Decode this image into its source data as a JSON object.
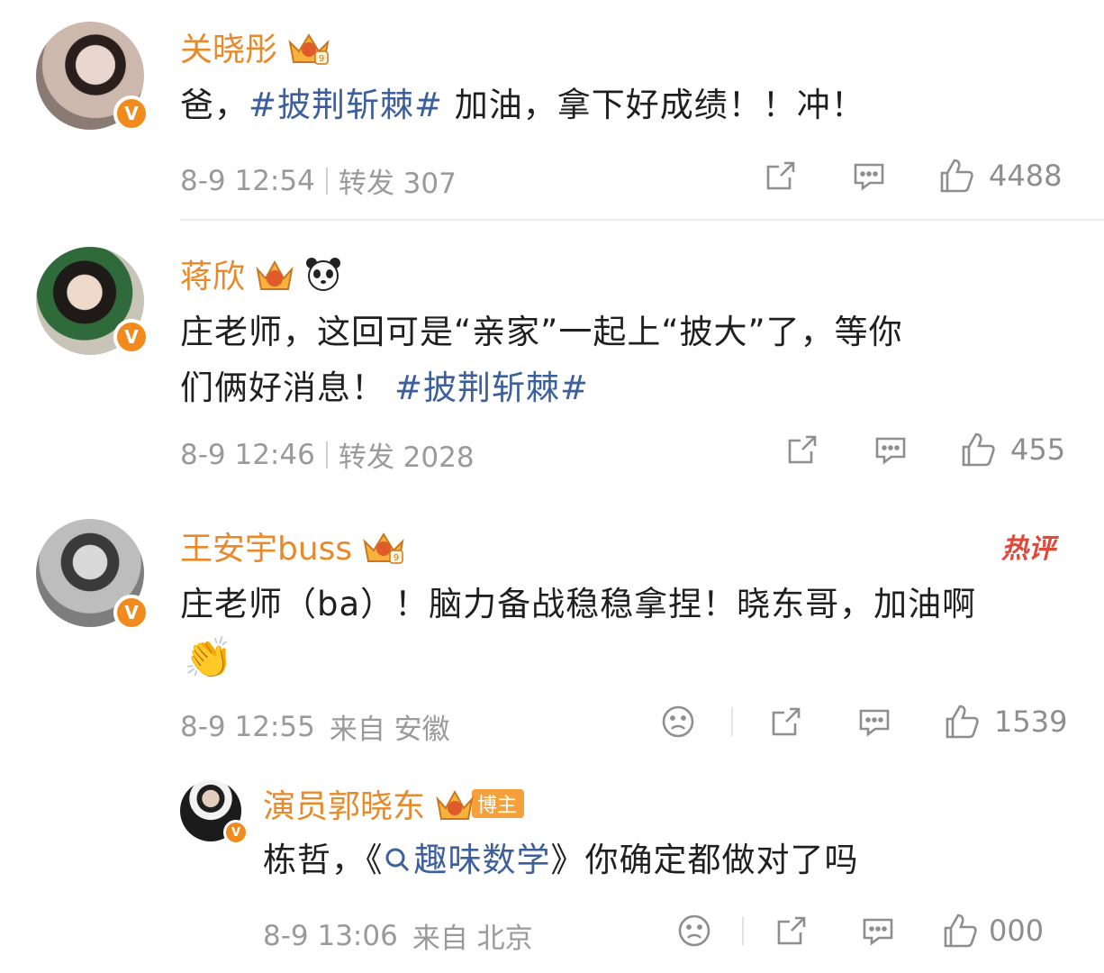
{
  "comments": [
    {
      "name": "关晓彤",
      "text_parts": [
        "爸，",
        "#披荆斩棘#",
        " 加油，拿下好成绩！！冲！"
      ],
      "time": "8-9 12:54",
      "repost": "转发 307",
      "likes": "4488"
    },
    {
      "name": "蒋欣",
      "text_line1": "庄老师，这回可是“亲家”一起上“披大”了，等你",
      "text_line2_plain": "们俩好消息！",
      "text_line2_tag": "#披荆斩棘#",
      "time": "8-9 12:46",
      "repost": "转发 2028",
      "likes": "455"
    },
    {
      "name": "王安宇buss",
      "hot_label": "热评",
      "text_line1": "庄老师（ba）！脑力备战稳稳拿捏！晓东哥，加油啊",
      "emoji": "👏",
      "time": "8-9 12:55",
      "location": "来自 安徽",
      "likes": "1539"
    }
  ],
  "reply": {
    "name": "演员郭晓东",
    "badge": "博主",
    "text_plain": "栋哲，《",
    "text_link": "趣味数学",
    "text_after": "》你确定都做对了吗",
    "time": "8-9 13:06",
    "location": "来自 北京",
    "likes": "000"
  },
  "colors": {
    "name": "#e8892a",
    "tag": "#3d5f9c",
    "meta": "#9a9a9a",
    "verified": "#f28b1d",
    "hot": "#e0483a"
  }
}
